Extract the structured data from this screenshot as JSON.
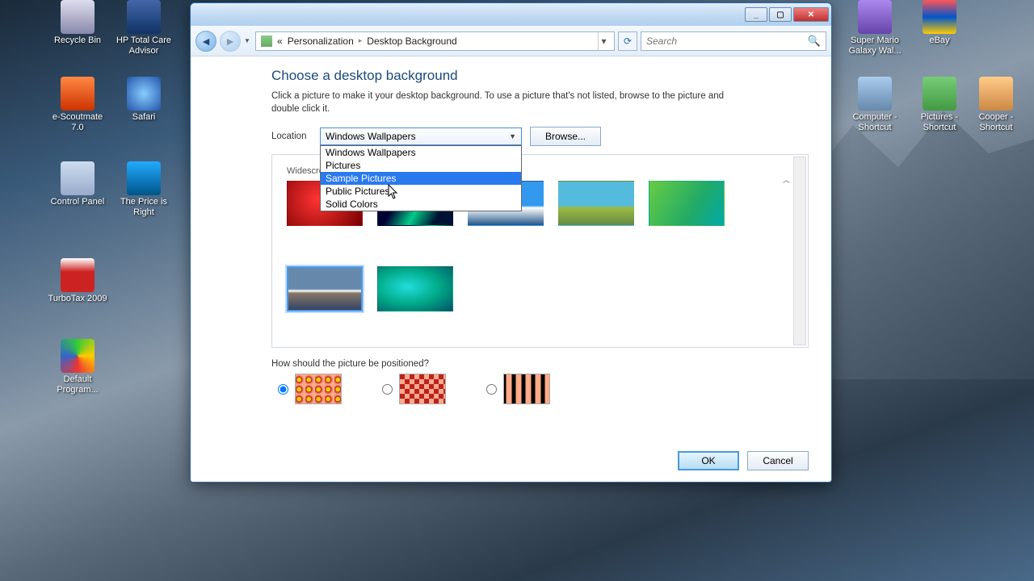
{
  "desktop_icons": {
    "left": [
      {
        "label": "Recycle Bin",
        "color": "linear-gradient(#dde,#88a)"
      },
      {
        "label": "HP Total Care Advisor",
        "color": "linear-gradient(#46a,#136)"
      },
      {
        "label": "e-Scoutmate 7.0",
        "color": "linear-gradient(#f84,#c30)"
      },
      {
        "label": "Safari",
        "color": "radial-gradient(circle,#8cf,#25a)"
      },
      {
        "label": "Control Panel",
        "color": "linear-gradient(#cde,#9ac)"
      },
      {
        "label": "The Price is Right",
        "color": "linear-gradient(#2af,#058)"
      },
      {
        "label": "TurboTax 2009",
        "color": "linear-gradient(#fff,#c22 40%,#c22)"
      },
      {
        "label": "Default Program...",
        "color": "conic-gradient(#3c3,#fc0,#e33,#36c,#3c3)"
      }
    ],
    "right": [
      {
        "label": "Super Mario Galaxy Wal...",
        "color": "linear-gradient(#a8e,#64a)"
      },
      {
        "label": "eBay",
        "color": "linear-gradient(#f55,#05c 50%,#fc0)"
      },
      {
        "label": "Computer - Shortcut",
        "color": "linear-gradient(#ace,#68a)"
      },
      {
        "label": "Pictures - Shortcut",
        "color": "linear-gradient(#7c7,#494)"
      },
      {
        "label": "Cooper - Shortcut",
        "color": "linear-gradient(#fc8,#c84)"
      }
    ]
  },
  "window": {
    "breadcrumb": {
      "pre": "«",
      "a": "Personalization",
      "b": "Desktop Background"
    },
    "search_placeholder": "Search",
    "heading": "Choose a desktop background",
    "description": "Click a picture to make it your desktop background. To use a picture that's not listed, browse to the picture and double click it.",
    "location_label": "Location",
    "location_selected": "Windows Wallpapers",
    "location_options": [
      "Windows Wallpapers",
      "Pictures",
      "Sample Pictures",
      "Public Pictures",
      "Solid Colors"
    ],
    "location_highlight_index": 2,
    "browse_label": "Browse...",
    "category_label": "Widescreen",
    "thumbnails": [
      {
        "bg": "radial-gradient(circle at 40% 40%, #f33, #700)"
      },
      {
        "bg": "linear-gradient(120deg,#003 30%,#0c8 55%,#013 80%)"
      },
      {
        "bg": "linear-gradient(#39e 55%,#fff 60%,#258)"
      },
      {
        "bg": "linear-gradient(#5bd 55%,#9b4 60%,#684)"
      },
      {
        "bg": "linear-gradient(120deg,#6c4,#2a6 60%,#0aa)"
      },
      {
        "bg": "linear-gradient(#68a 50%,#fff 55%,#876 60%,#346)"
      },
      {
        "bg": "radial-gradient(ellipse at 40% 45%,#2dd,#0a8 50%,#056)"
      }
    ],
    "position_question": "How should the picture be positioned?",
    "position_options": [
      {
        "bg": "radial-gradient(circle at 35% 55%,#fc0 25%,#b22 30%,#fa8 60%)"
      },
      {
        "bg": "repeating-conic-gradient(#fa8 0 25%,#b22 0 50%)"
      },
      {
        "bg": "linear-gradient(90deg,#000 20%,#fa8 20% 80%,#000 80%)"
      }
    ],
    "ok_label": "OK",
    "cancel_label": "Cancel"
  }
}
